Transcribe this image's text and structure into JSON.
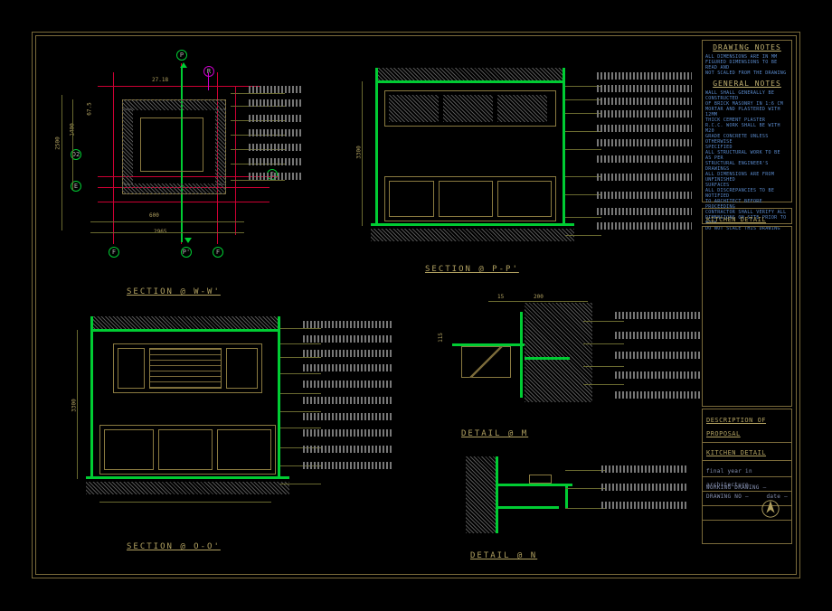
{
  "sections": {
    "ww": {
      "title": "SECTION @ W-W'",
      "dims": {
        "h": "1400",
        "h2": "67.5",
        "w": "2965",
        "sub": "600",
        "ht": "2500",
        "top": "27.18"
      },
      "grids": [
        "D2",
        "E",
        "F",
        "P",
        "P'",
        "R"
      ]
    },
    "pp": {
      "title": "SECTION @ P-P'",
      "dim": "3300"
    },
    "oo": {
      "title": "SECTION @ O-O'",
      "dim": "3300"
    },
    "m": {
      "title": "DETAIL @ M",
      "dims": {
        "a": "15",
        "b": "200",
        "c": "115"
      }
    },
    "n": {
      "title": "DETAIL @ N"
    }
  },
  "titleblock": {
    "sheet_title": "KITCHEN DETAIL",
    "desc_head": "DESCRIPTION OF PROPOSAL",
    "desc": "KITCHEN DETAIL",
    "course": "final year in architecture",
    "drawing_label": "WORKING DRAWING —",
    "drawing_no_label": "DRAWING NO —",
    "date_label": "date —"
  },
  "notes": {
    "drawing_title": "DRAWING NOTES",
    "general_title": "GENERAL NOTES",
    "drawing_lines": [
      "ALL DIMENSIONS ARE IN MM",
      "FIGURED DIMENSIONS TO BE READ AND",
      "NOT SCALED FROM THE DRAWING"
    ],
    "general_lines": [
      "WALL SHALL GENERALLY BE CONSTRUCTED",
      "OF BRICK MASONRY IN 1:6 CM",
      "MORTAR AND PLASTERED WITH 12MM",
      "THICK CEMENT PLASTER",
      "R.C.C. WORK SHALL BE WITH M20",
      "GRADE CONCRETE UNLESS OTHERWISE",
      "SPECIFIED",
      "ALL STRUCTURAL WORK TO BE AS PER",
      "STRUCTURAL ENGINEER'S DRAWINGS",
      "ALL DIMENSIONS ARE FROM UNFINISHED",
      "SURFACES",
      "ALL DISCREPANCIES TO BE NOTIFIED",
      "TO ARCHITECT BEFORE PROCEEDING",
      "CONTRACTOR SHALL VERIFY ALL",
      "DIMENSIONS ON SITE PRIOR TO WORK",
      "DO NOT SCALE THIS DRAWING"
    ]
  },
  "annotations": [
    "",
    "",
    "",
    "",
    "",
    "",
    "",
    "",
    "",
    "",
    "",
    "",
    "",
    ""
  ]
}
